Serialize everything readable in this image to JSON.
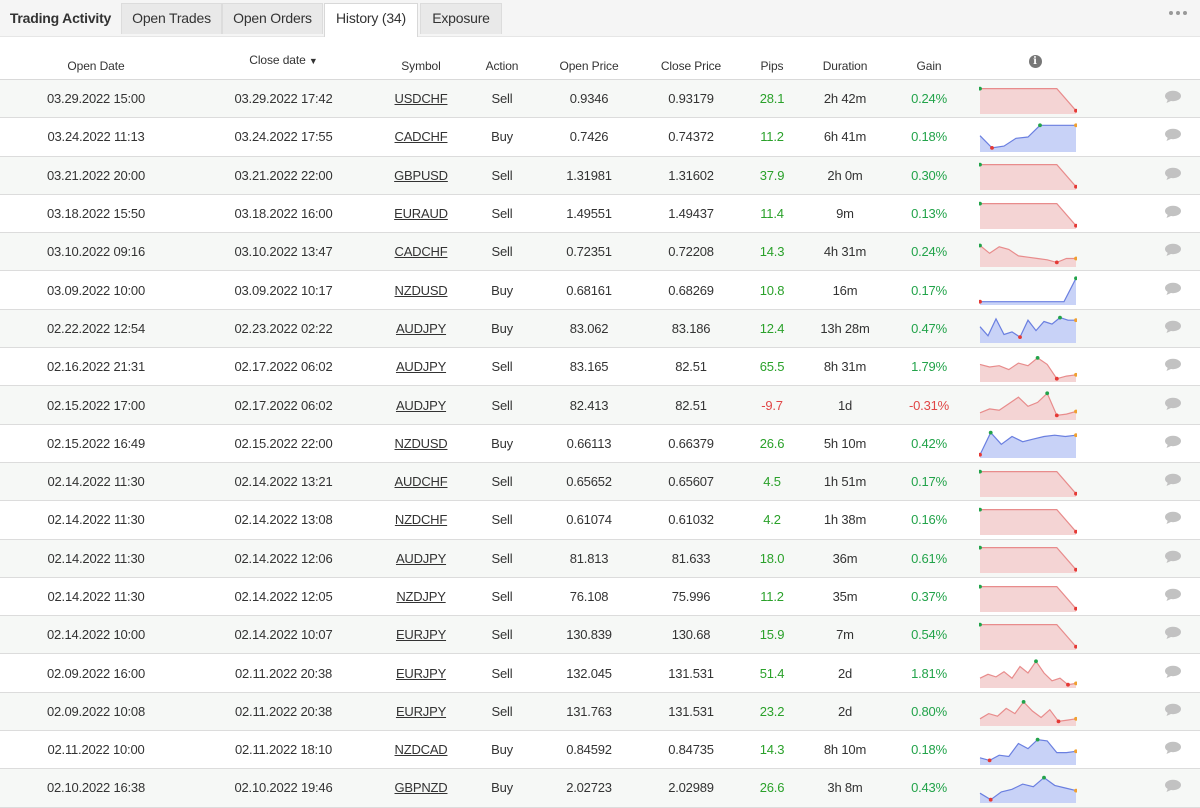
{
  "tabs": {
    "title": "Trading Activity",
    "items": [
      "Open Trades",
      "Open Orders",
      "History (34)",
      "Exposure"
    ],
    "active_index": 2
  },
  "table": {
    "headers": {
      "open_date": "Open Date",
      "close_date": "Close date",
      "sort_indicator": "▼",
      "symbol": "Symbol",
      "action": "Action",
      "open_price": "Open Price",
      "close_price": "Close Price",
      "pips": "Pips",
      "duration": "Duration",
      "gain": "Gain",
      "info": "i"
    },
    "colors": {
      "profit": "#2aa12a",
      "loss": "#e04646",
      "sell_fill": "#f4d4d4",
      "sell_line": "#e88c8c",
      "buy_fill": "#c8d2f7",
      "buy_line": "#6a7fe0"
    },
    "rows": [
      {
        "open_date": "03.29.2022 15:00",
        "close_date": "03.29.2022 17:42",
        "symbol": "USDCHF",
        "action": "Sell",
        "open_price": "0.9346",
        "close_price": "0.93179",
        "pips": "28.1",
        "duration": "2h 42m",
        "gain": "0.24%",
        "spark": [
          0.9,
          0.9,
          0.9,
          0.9,
          0.9,
          0.05
        ]
      },
      {
        "open_date": "03.24.2022 11:13",
        "close_date": "03.24.2022 17:55",
        "symbol": "CADCHF",
        "action": "Buy",
        "open_price": "0.7426",
        "close_price": "0.74372",
        "pips": "11.2",
        "duration": "6h 41m",
        "gain": "0.18%",
        "spark": [
          0.55,
          0.08,
          0.15,
          0.45,
          0.5,
          0.95,
          0.95,
          0.95,
          0.95
        ]
      },
      {
        "open_date": "03.21.2022 20:00",
        "close_date": "03.21.2022 22:00",
        "symbol": "GBPUSD",
        "action": "Sell",
        "open_price": "1.31981",
        "close_price": "1.31602",
        "pips": "37.9",
        "duration": "2h 0m",
        "gain": "0.30%",
        "spark": [
          0.9,
          0.9,
          0.9,
          0.9,
          0.9,
          0.05
        ]
      },
      {
        "open_date": "03.18.2022 15:50",
        "close_date": "03.18.2022 16:00",
        "symbol": "EURAUD",
        "action": "Sell",
        "open_price": "1.49551",
        "close_price": "1.49437",
        "pips": "11.4",
        "duration": "9m",
        "gain": "0.13%",
        "spark": [
          0.9,
          0.9,
          0.9,
          0.9,
          0.9,
          0.05
        ]
      },
      {
        "open_date": "03.10.2022 09:16",
        "close_date": "03.10.2022 13:47",
        "symbol": "CADCHF",
        "action": "Sell",
        "open_price": "0.72351",
        "close_price": "0.72208",
        "pips": "14.3",
        "duration": "4h 31m",
        "gain": "0.24%",
        "spark": [
          0.75,
          0.45,
          0.7,
          0.6,
          0.35,
          0.3,
          0.25,
          0.2,
          0.1,
          0.25,
          0.25
        ]
      },
      {
        "open_date": "03.09.2022 10:00",
        "close_date": "03.09.2022 10:17",
        "symbol": "NZDUSD",
        "action": "Buy",
        "open_price": "0.68161",
        "close_price": "0.68269",
        "pips": "10.8",
        "duration": "16m",
        "gain": "0.17%",
        "spark": [
          0.05,
          0.05,
          0.05,
          0.05,
          0.05,
          0.05,
          0.05,
          0.05,
          0.95
        ]
      },
      {
        "open_date": "02.22.2022 12:54",
        "close_date": "02.23.2022 02:22",
        "symbol": "AUDJPY",
        "action": "Buy",
        "open_price": "83.062",
        "close_price": "83.186",
        "pips": "12.4",
        "duration": "13h 28m",
        "gain": "0.47%",
        "spark": [
          0.55,
          0.2,
          0.85,
          0.25,
          0.35,
          0.15,
          0.8,
          0.4,
          0.75,
          0.65,
          0.9,
          0.8,
          0.8
        ]
      },
      {
        "open_date": "02.16.2022 21:31",
        "close_date": "02.17.2022 06:02",
        "symbol": "AUDJPY",
        "action": "Sell",
        "open_price": "83.165",
        "close_price": "82.51",
        "pips": "65.5",
        "duration": "8h 31m",
        "gain": "1.79%",
        "spark": [
          0.6,
          0.5,
          0.55,
          0.4,
          0.65,
          0.55,
          0.85,
          0.6,
          0.05,
          0.15,
          0.2
        ]
      },
      {
        "open_date": "02.15.2022 17:00",
        "close_date": "02.17.2022 06:02",
        "symbol": "AUDJPY",
        "action": "Sell",
        "open_price": "82.413",
        "close_price": "82.51",
        "pips": "-9.7",
        "duration": "1d",
        "gain": "-0.31%",
        "spark": [
          0.2,
          0.35,
          0.3,
          0.55,
          0.8,
          0.45,
          0.6,
          0.95,
          0.1,
          0.15,
          0.25
        ]
      },
      {
        "open_date": "02.15.2022 16:49",
        "close_date": "02.15.2022 22:00",
        "symbol": "NZDUSD",
        "action": "Buy",
        "open_price": "0.66113",
        "close_price": "0.66379",
        "pips": "26.6",
        "duration": "5h 10m",
        "gain": "0.42%",
        "spark": [
          0.05,
          0.9,
          0.45,
          0.75,
          0.55,
          0.65,
          0.75,
          0.8,
          0.75,
          0.8
        ]
      },
      {
        "open_date": "02.14.2022 11:30",
        "close_date": "02.14.2022 13:21",
        "symbol": "AUDCHF",
        "action": "Sell",
        "open_price": "0.65652",
        "close_price": "0.65607",
        "pips": "4.5",
        "duration": "1h 51m",
        "gain": "0.17%",
        "spark": [
          0.9,
          0.9,
          0.9,
          0.9,
          0.9,
          0.05
        ]
      },
      {
        "open_date": "02.14.2022 11:30",
        "close_date": "02.14.2022 13:08",
        "symbol": "NZDCHF",
        "action": "Sell",
        "open_price": "0.61074",
        "close_price": "0.61032",
        "pips": "4.2",
        "duration": "1h 38m",
        "gain": "0.16%",
        "spark": [
          0.9,
          0.9,
          0.9,
          0.9,
          0.9,
          0.05
        ]
      },
      {
        "open_date": "02.14.2022 11:30",
        "close_date": "02.14.2022 12:06",
        "symbol": "AUDJPY",
        "action": "Sell",
        "open_price": "81.813",
        "close_price": "81.633",
        "pips": "18.0",
        "duration": "36m",
        "gain": "0.61%",
        "spark": [
          0.9,
          0.9,
          0.9,
          0.9,
          0.9,
          0.05
        ]
      },
      {
        "open_date": "02.14.2022 11:30",
        "close_date": "02.14.2022 12:05",
        "symbol": "NZDJPY",
        "action": "Sell",
        "open_price": "76.108",
        "close_price": "75.996",
        "pips": "11.2",
        "duration": "35m",
        "gain": "0.37%",
        "spark": [
          0.9,
          0.9,
          0.9,
          0.9,
          0.9,
          0.05
        ]
      },
      {
        "open_date": "02.14.2022 10:00",
        "close_date": "02.14.2022 10:07",
        "symbol": "EURJPY",
        "action": "Sell",
        "open_price": "130.839",
        "close_price": "130.68",
        "pips": "15.9",
        "duration": "7m",
        "gain": "0.54%",
        "spark": [
          0.9,
          0.9,
          0.9,
          0.9,
          0.9,
          0.05
        ]
      },
      {
        "open_date": "02.09.2022 16:00",
        "close_date": "02.11.2022 20:38",
        "symbol": "EURJPY",
        "action": "Sell",
        "open_price": "132.045",
        "close_price": "131.531",
        "pips": "51.4",
        "duration": "2d",
        "gain": "1.81%",
        "spark": [
          0.3,
          0.45,
          0.35,
          0.55,
          0.3,
          0.75,
          0.5,
          0.95,
          0.5,
          0.2,
          0.3,
          0.05,
          0.1
        ]
      },
      {
        "open_date": "02.09.2022 10:08",
        "close_date": "02.11.2022 20:38",
        "symbol": "EURJPY",
        "action": "Sell",
        "open_price": "131.763",
        "close_price": "131.531",
        "pips": "23.2",
        "duration": "2d",
        "gain": "0.80%",
        "spark": [
          0.2,
          0.4,
          0.3,
          0.6,
          0.4,
          0.85,
          0.5,
          0.25,
          0.55,
          0.1,
          0.15,
          0.2
        ]
      },
      {
        "open_date": "02.11.2022 10:00",
        "close_date": "02.11.2022 18:10",
        "symbol": "NZDCAD",
        "action": "Buy",
        "open_price": "0.84592",
        "close_price": "0.84735",
        "pips": "14.3",
        "duration": "8h 10m",
        "gain": "0.18%",
        "spark": [
          0.2,
          0.1,
          0.3,
          0.25,
          0.75,
          0.55,
          0.9,
          0.85,
          0.4,
          0.4,
          0.45
        ]
      },
      {
        "open_date": "02.10.2022 16:38",
        "close_date": "02.10.2022 19:46",
        "symbol": "GBPNZD",
        "action": "Buy",
        "open_price": "2.02723",
        "close_price": "2.02989",
        "pips": "26.6",
        "duration": "3h 8m",
        "gain": "0.43%",
        "spark": [
          0.3,
          0.05,
          0.35,
          0.45,
          0.65,
          0.55,
          0.9,
          0.6,
          0.5,
          0.4
        ]
      }
    ]
  }
}
